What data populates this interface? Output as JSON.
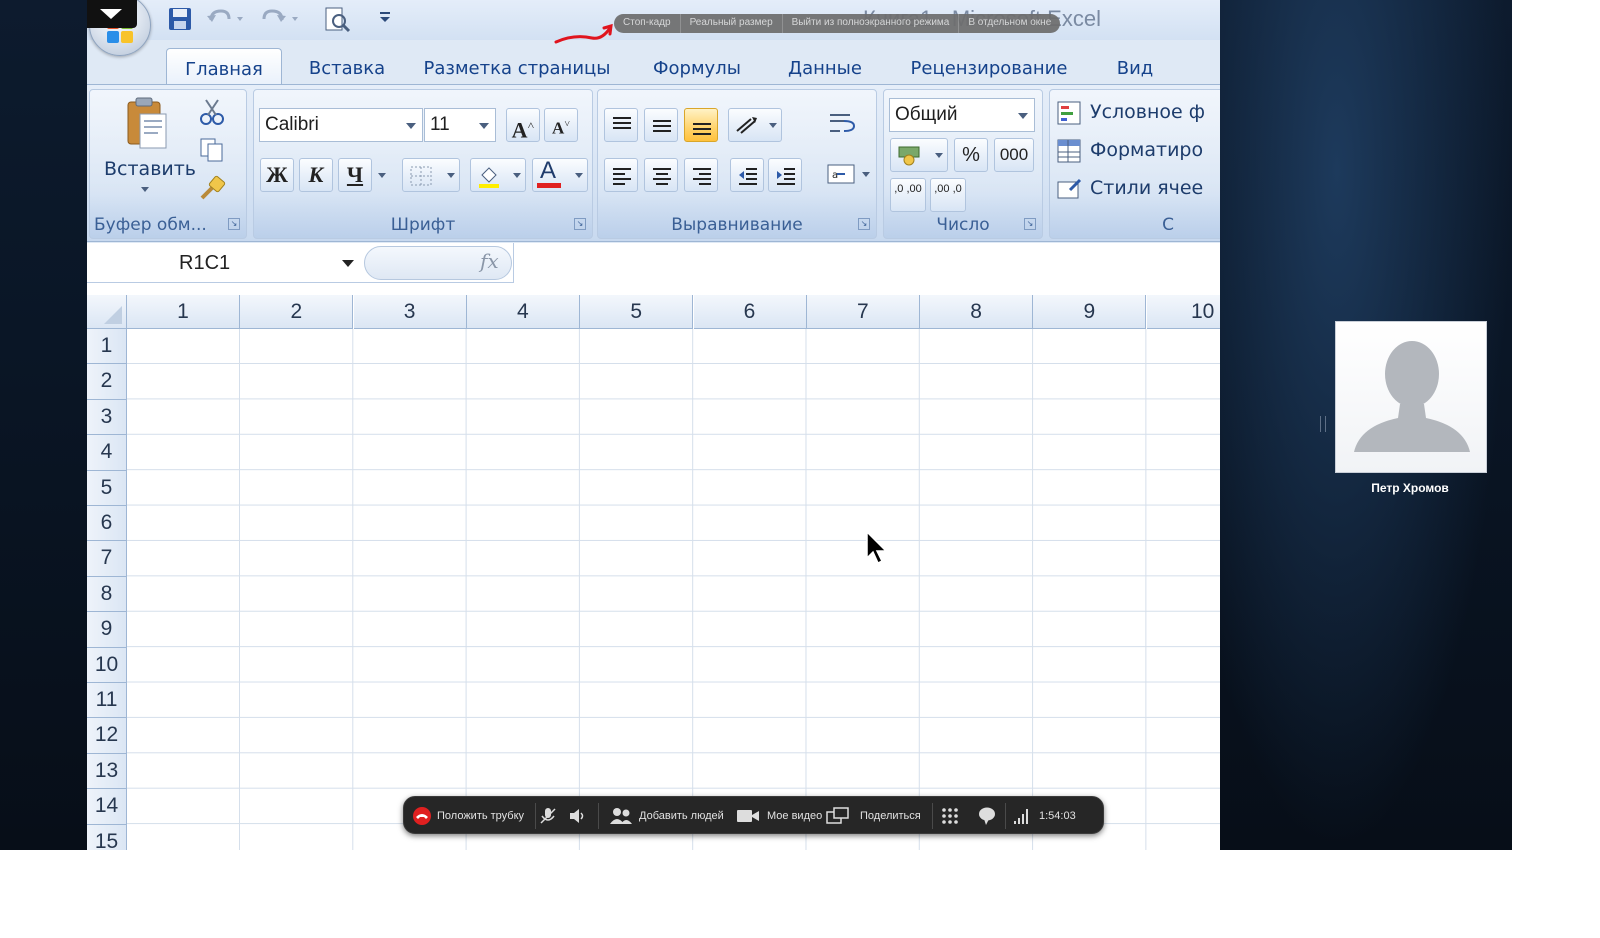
{
  "window": {
    "title": "Книга1 - Microsoft Excel",
    "quick_access": [
      "save-icon",
      "undo-icon",
      "redo-icon",
      "print-preview-icon",
      "customize-qat-icon"
    ]
  },
  "fullscreen_bar": {
    "buttons": [
      "Стоп-кадр",
      "Реальный размер",
      "Выйти из полноэкранного режима",
      "В отдельном окне"
    ]
  },
  "tabs": [
    "Главная",
    "Вставка",
    "Разметка страницы",
    "Формулы",
    "Данные",
    "Рецензирование",
    "Вид"
  ],
  "active_tab": "Главная",
  "ribbon": {
    "clipboard": {
      "label": "Буфер обм...",
      "paste_label": "Вставить"
    },
    "font": {
      "label": "Шрифт",
      "font_name": "Calibri",
      "font_size": "11",
      "grow": "A",
      "shrink": "A",
      "bold": "Ж",
      "italic": "К",
      "underline": "Ч",
      "font_color_letter": "A"
    },
    "alignment": {
      "label": "Выравнивание"
    },
    "number": {
      "label": "Число",
      "format": "Общий",
      "percent": "%",
      "thousands": "000",
      "inc_decimal": ",0 ,00",
      "dec_decimal": ",00 ,0"
    },
    "styles": {
      "items": [
        "Условное ф",
        "Форматиро",
        "Стили ячее"
      ],
      "label_fragment": "С"
    }
  },
  "formula_bar": {
    "name_box": "R1C1",
    "fx": "fx",
    "value": ""
  },
  "grid": {
    "columns": [
      "1",
      "2",
      "3",
      "4",
      "5",
      "6",
      "7",
      "8",
      "9",
      "10"
    ],
    "rows": [
      "1",
      "2",
      "3",
      "4",
      "5",
      "6",
      "7",
      "8",
      "9",
      "10",
      "11",
      "12",
      "13",
      "14",
      "15"
    ]
  },
  "call_toolbar": {
    "hangup": "Положить трубку",
    "add_people": "Добавить людей",
    "my_video": "Мое видео",
    "share": "Поделиться",
    "duration": "1:54:03"
  },
  "participant": {
    "name": "Петр Хромов"
  },
  "colors": {
    "ribbon_blue": "#15428b",
    "hangup_red": "#e02020",
    "annotation_red": "#e0141e",
    "active_align": "#ffc13c"
  }
}
